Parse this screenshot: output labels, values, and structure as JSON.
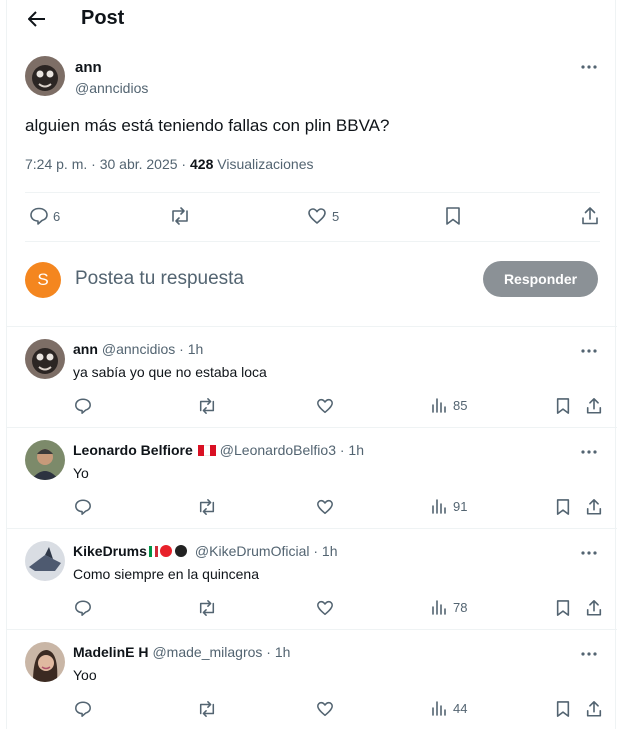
{
  "header": {
    "title": "Post",
    "back_icon": "arrow-left-icon"
  },
  "post": {
    "author_name": "ann",
    "author_handle": "@anncidios",
    "text": "alguien más está teniendo fallas con plin BBVA?",
    "meta_time": "7:24 p. m. · 30 abr. 2025 ·",
    "view_count": "428",
    "views_label": "Visualizaciones",
    "reply_count": "6",
    "like_count": "5"
  },
  "compose": {
    "avatar_letter": "S",
    "avatar_color": "#f4861f",
    "placeholder": "Postea tu respuesta",
    "button_label": "Responder"
  },
  "replies": [
    {
      "name": "ann",
      "handle": "@anncidios · 1h",
      "text": "ya sabía yo que no estaba loca",
      "views": "85"
    },
    {
      "name": "Leonardo Belfiore",
      "handle": "@LeonardoBelfio3 · 1h",
      "text": "Yo",
      "views": "91"
    },
    {
      "name": "KikeDrums",
      "handle": "@KikeDrumOficial · 1h",
      "text": "Como siempre en la quincena",
      "views": "78"
    },
    {
      "name": "MadelinE H",
      "handle": "@made_milagros · 1h",
      "text": "Yoo",
      "views": "44"
    }
  ],
  "colors": {
    "text": "#0f1419",
    "secondary": "#536471",
    "divider": "#eff3f4",
    "button_disabled": "#8b9196"
  }
}
